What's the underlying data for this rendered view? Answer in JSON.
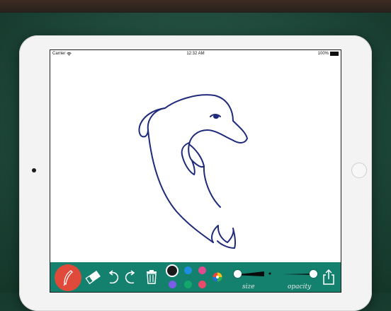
{
  "status_bar": {
    "carrier": "Carrier",
    "time": "12:32 AM",
    "battery": "100%"
  },
  "icons": {
    "wifi": "wifi-icon",
    "battery": "battery-icon",
    "brush": "feather-brush-icon",
    "eraser": "eraser-icon",
    "undo": "undo-icon",
    "redo": "redo-icon",
    "trash": "trash-icon",
    "palette": "color-wheel-icon",
    "share": "share-icon"
  },
  "colors": {
    "toolbar_bg": "#14806e",
    "brush_button": "#e04a3a",
    "stroke": "#1f2a7a",
    "swatches_top": [
      "#1a1a1a",
      "#1e8fe0",
      "#e04a8f"
    ],
    "swatches_bottom": [
      "#7b5ce8",
      "#12a86b",
      "#e84a6a"
    ]
  },
  "toolbar": {
    "size_label": "size",
    "opacity_label": "opacity",
    "size_level": 0.1,
    "opacity_level": 0.9
  }
}
